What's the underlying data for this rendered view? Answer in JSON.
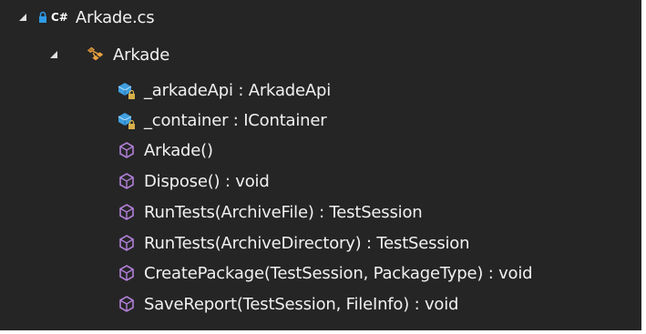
{
  "tree": {
    "file": {
      "name": "Arkade.cs",
      "lang_badge": "C#"
    },
    "class_node": {
      "name": "Arkade"
    },
    "members": [
      {
        "icon": "private-field-icon",
        "label": "_arkadeApi : ArkadeApi"
      },
      {
        "icon": "private-field-icon",
        "label": "_container : IContainer"
      },
      {
        "icon": "method-icon",
        "label": "Arkade()"
      },
      {
        "icon": "method-icon",
        "label": "Dispose() : void"
      },
      {
        "icon": "method-icon",
        "label": "RunTests(ArchiveFile) : TestSession"
      },
      {
        "icon": "method-icon",
        "label": "RunTests(ArchiveDirectory) : TestSession"
      },
      {
        "icon": "method-icon",
        "label": "CreatePackage(TestSession, PackageType) : void"
      },
      {
        "icon": "method-icon",
        "label": "SaveReport(TestSession, FileInfo) : void"
      }
    ]
  },
  "colors": {
    "background": "#252526",
    "text": "#f1f1f1",
    "method_purple": "#b180d7",
    "field_blue": "#3f9fe0",
    "class_orange": "#e8a040",
    "lock_yellow": "#d8b04a"
  }
}
